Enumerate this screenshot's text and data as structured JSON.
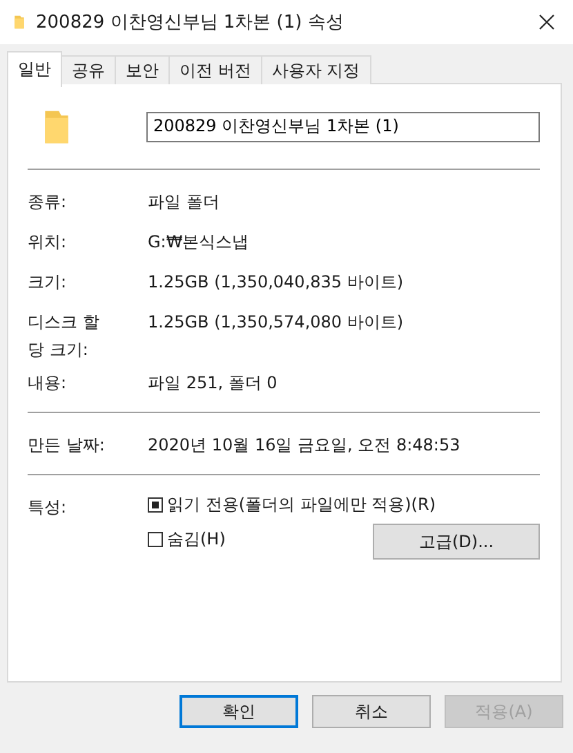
{
  "window": {
    "title": "200829 이찬영신부님 1차본 (1) 속성"
  },
  "tabs": [
    {
      "label": "일반",
      "selected": true
    },
    {
      "label": "공유",
      "selected": false
    },
    {
      "label": "보안",
      "selected": false
    },
    {
      "label": "이전 버전",
      "selected": false
    },
    {
      "label": "사용자 지정",
      "selected": false
    }
  ],
  "name_field": {
    "value": "200829 이찬영신부님 1차본 (1)"
  },
  "sections": [
    [
      {
        "label": "종류:",
        "value": "파일 폴더"
      },
      {
        "label": "위치:",
        "value": "G:₩본식스냅"
      },
      {
        "label": "크기:",
        "value": "1.25GB (1,350,040,835 바이트)"
      },
      {
        "label": "디스크 할당 크기:",
        "value": "1.25GB (1,350,574,080 바이트)"
      },
      {
        "label": "내용:",
        "value": "파일 251, 폴더 0"
      }
    ],
    [
      {
        "label": "만든 날짜:",
        "value": "2020년 10월 16일 금요일, 오전 8:48:53"
      }
    ]
  ],
  "attributes": {
    "label": "특성:",
    "options": [
      {
        "label": "읽기 전용(폴더의 파일에만 적용)(R)",
        "checked": false,
        "indeterminate": true
      },
      {
        "label": "숨김(H)",
        "checked": false,
        "indeterminate": false
      }
    ],
    "advanced_button": "고급(D)..."
  },
  "buttons": [
    {
      "label": "확인",
      "default": true,
      "disabled": false
    },
    {
      "label": "취소",
      "default": false,
      "disabled": false
    },
    {
      "label": "적용(A)",
      "default": false,
      "disabled": true
    }
  ]
}
